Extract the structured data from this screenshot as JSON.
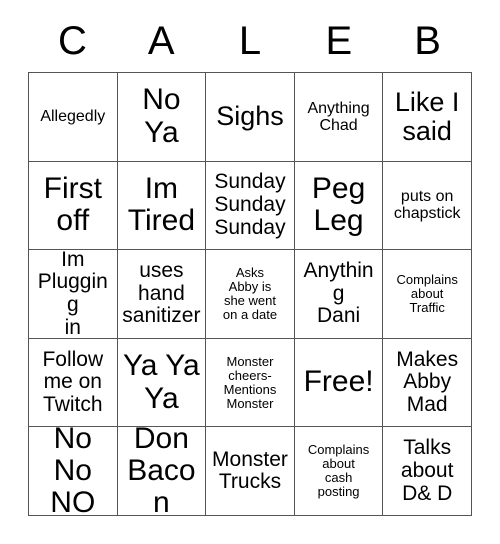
{
  "card": {
    "header_letters": [
      "C",
      "A",
      "L",
      "E",
      "B"
    ],
    "columns": 5,
    "rows": 5,
    "grid": [
      [
        {
          "text": "Allegedly",
          "size": "sm",
          "free": false
        },
        {
          "text": "No\nYa",
          "size": "xl",
          "free": false
        },
        {
          "text": "Sighs",
          "size": "lg",
          "free": false
        },
        {
          "text": "Anything\nChad",
          "size": "sm",
          "free": false
        },
        {
          "text": "Like I\nsaid",
          "size": "lg",
          "free": false
        }
      ],
      [
        {
          "text": "First\noff",
          "size": "xl",
          "free": false
        },
        {
          "text": "Im\nTired",
          "size": "xl",
          "free": false
        },
        {
          "text": "Sunday\nSunday\nSunday",
          "size": "md",
          "free": false
        },
        {
          "text": "Peg\nLeg",
          "size": "xl",
          "free": false
        },
        {
          "text": "puts on\nchapstick",
          "size": "sm",
          "free": false
        }
      ],
      [
        {
          "text": "Im\nPlugging\nin",
          "size": "md",
          "free": false
        },
        {
          "text": "uses\nhand\nsanitizer",
          "size": "md",
          "free": false
        },
        {
          "text": "Asks\nAbby is\nshe went\non a date",
          "size": "xs",
          "free": false
        },
        {
          "text": "Anything\nDani",
          "size": "md",
          "free": false
        },
        {
          "text": "Complains\nabout\nTraffic",
          "size": "xs",
          "free": false
        }
      ],
      [
        {
          "text": "Follow\nme on\nTwitch",
          "size": "md",
          "free": false
        },
        {
          "text": "Ya Ya\nYa",
          "size": "xl",
          "free": false
        },
        {
          "text": "Monster\ncheers-\nMentions\nMonster",
          "size": "xs",
          "free": false
        },
        {
          "text": "Free!",
          "size": "xl",
          "free": true
        },
        {
          "text": "Makes\nAbby\nMad",
          "size": "md",
          "free": false
        }
      ],
      [
        {
          "text": "No No\nNO",
          "size": "xl",
          "free": false
        },
        {
          "text": "Don\nBacon",
          "size": "xl",
          "free": false
        },
        {
          "text": "Monster\nTrucks",
          "size": "md",
          "free": false
        },
        {
          "text": "Complains\nabout\ncash\nposting",
          "size": "xs",
          "free": false
        },
        {
          "text": "Talks\nabout\nD& D",
          "size": "md",
          "free": false
        }
      ]
    ]
  },
  "colors": {
    "background": "#ffffff",
    "text": "#000000",
    "grid_line": "#555555"
  }
}
